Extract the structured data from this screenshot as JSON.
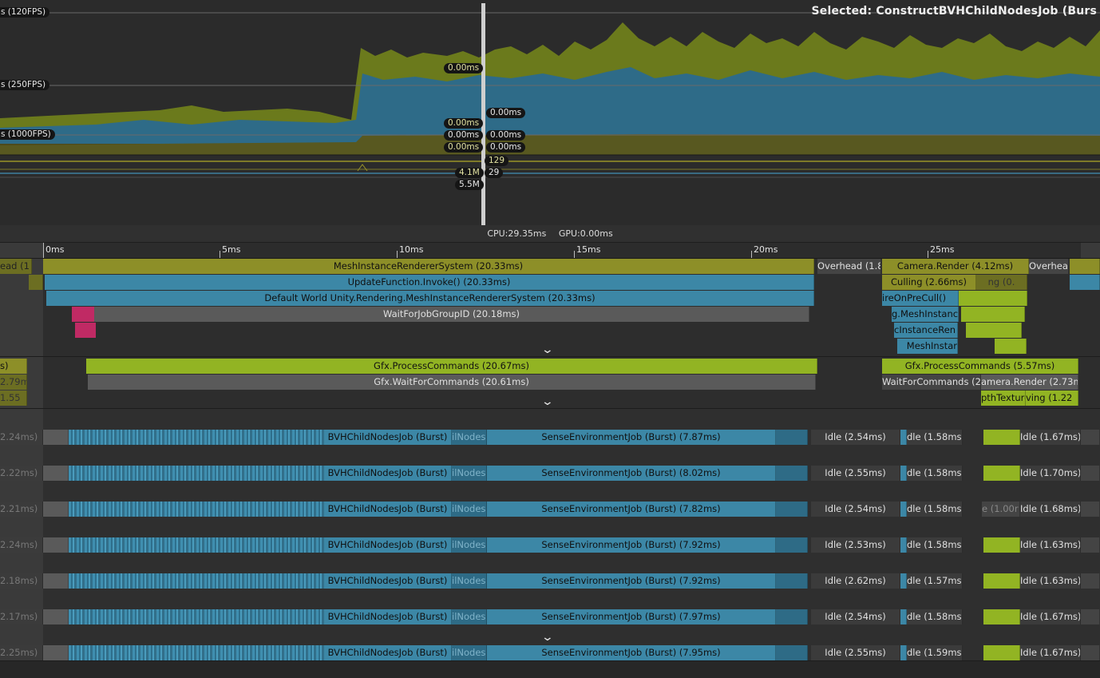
{
  "header": {
    "selected_label": "Selected: ConstructBVHChildNodesJob (Burs"
  },
  "chart": {
    "fps_labels": [
      "s (120FPS)",
      "s (250FPS)",
      "s (1000FPS)"
    ],
    "value_pills": {
      "a": "0.00ms",
      "b": "0.00ms",
      "c": "0.00ms",
      "d": "0.00ms",
      "e": "0.00ms",
      "f": "0.00ms",
      "g": "0.00ms",
      "h": "129",
      "i": "4.1M",
      "j": "29",
      "k": "5.5M"
    },
    "colors": {
      "cpu_yellow": "#7b8a1e",
      "cpu_blue": "#2f6d8a",
      "base": "#575420"
    }
  },
  "stats": {
    "cpu": "CPU:29.35ms",
    "gpu": "GPU:0.00ms"
  },
  "ruler": {
    "labels": [
      "0ms",
      "5ms",
      "10ms",
      "15ms",
      "20ms",
      "25ms"
    ]
  },
  "main_thread": {
    "row1": {
      "left": "ead (1",
      "center": "MeshInstanceRendererSystem (20.33ms)",
      "overhead": "Overhead (1.8",
      "camera": "Camera.Render (4.12ms)",
      "overhead2": "Overhead ("
    },
    "row2": {
      "center": "UpdateFunction.Invoke() (20.33ms)",
      "culling": "Culling (2.66ms)",
      "right": "ng (0."
    },
    "row3": {
      "center": "Default World Unity.Rendering.MeshInstanceRendererSystem (20.33ms)",
      "right": "ireOnPreCull()"
    },
    "row4": {
      "center": "WaitForJobGroupID (20.18ms)",
      "right": "g.MeshInstanc"
    },
    "row5": {
      "right": "cInstanceRen"
    },
    "row6": {
      "right": "MeshInstar"
    }
  },
  "render_thread": {
    "row1": {
      "left": "s)",
      "center": "Gfx.ProcessCommands (20.67ms)",
      "right": "Gfx.ProcessCommands (5.57ms)"
    },
    "row2": {
      "left": "2.79m",
      "center": "Gfx.WaitForCommands (20.61ms)",
      "right": "WaitForCommands (2.6",
      "right2": "amera.Render (2.73m"
    },
    "row3": {
      "left": "1.55",
      "right": "pthTexture",
      "right2": "ving (1.22"
    }
  },
  "workers": [
    {
      "left": "2.24ms)",
      "bvh": "BVHChildNodesJob (Burst)",
      "nodes": "ilNodes",
      "sense": "SenseEnvironmentJob (Burst) (7.87ms)",
      "idle1": "Idle (2.54ms)",
      "idle2": "dle (1.58ms",
      "idle3": "Idle (1.67ms)"
    },
    {
      "left": "2.22ms)",
      "bvh": "BVHChildNodesJob (Burst)",
      "nodes": "ilNodes",
      "sense": "SenseEnvironmentJob (Burst) (8.02ms)",
      "idle1": "Idle (2.55ms)",
      "idle2": "dle (1.58ms",
      "idle3": "Idle (1.70ms)"
    },
    {
      "left": "2.21ms)",
      "bvh": "BVHChildNodesJob (Burst)",
      "nodes": "ilNodes",
      "sense": "SenseEnvironmentJob (Burst) (7.82ms)",
      "idle1": "Idle (2.54ms)",
      "idle2": "dle (1.58ms",
      "idle3": "Idle (1.68ms)",
      "extra": "e (1.00r"
    },
    {
      "left": "2.24ms)",
      "bvh": "BVHChildNodesJob (Burst)",
      "nodes": "ilNodes",
      "sense": "SenseEnvironmentJob (Burst) (7.92ms)",
      "idle1": "Idle (2.53ms)",
      "idle2": "dle (1.58ms",
      "idle3": "Idle (1.63ms)"
    },
    {
      "left": "2.18ms)",
      "bvh": "BVHChildNodesJob (Burst)",
      "nodes": "ilNodes",
      "sense": "SenseEnvironmentJob (Burst) (7.92ms)",
      "idle1": "Idle (2.62ms)",
      "idle2": "dle (1.57ms",
      "idle3": "Idle (1.63ms)"
    },
    {
      "left": "2.17ms)",
      "bvh": "BVHChildNodesJob (Burst)",
      "nodes": "ilNodes",
      "sense": "SenseEnvironmentJob (Burst) (7.97ms)",
      "idle1": "Idle (2.54ms)",
      "idle2": "dle (1.58ms",
      "idle3": "Idle (1.67ms)"
    },
    {
      "left": "2.25ms)",
      "bvh": "BVHChildNodesJob (Burst)",
      "nodes": "ilNodes",
      "sense": "SenseEnvironmentJob (Burst) (7.95ms)",
      "idle1": "Idle (2.55ms)",
      "idle2": "dle (1.59ms",
      "idle3": "Idle (1.67ms)"
    }
  ]
}
